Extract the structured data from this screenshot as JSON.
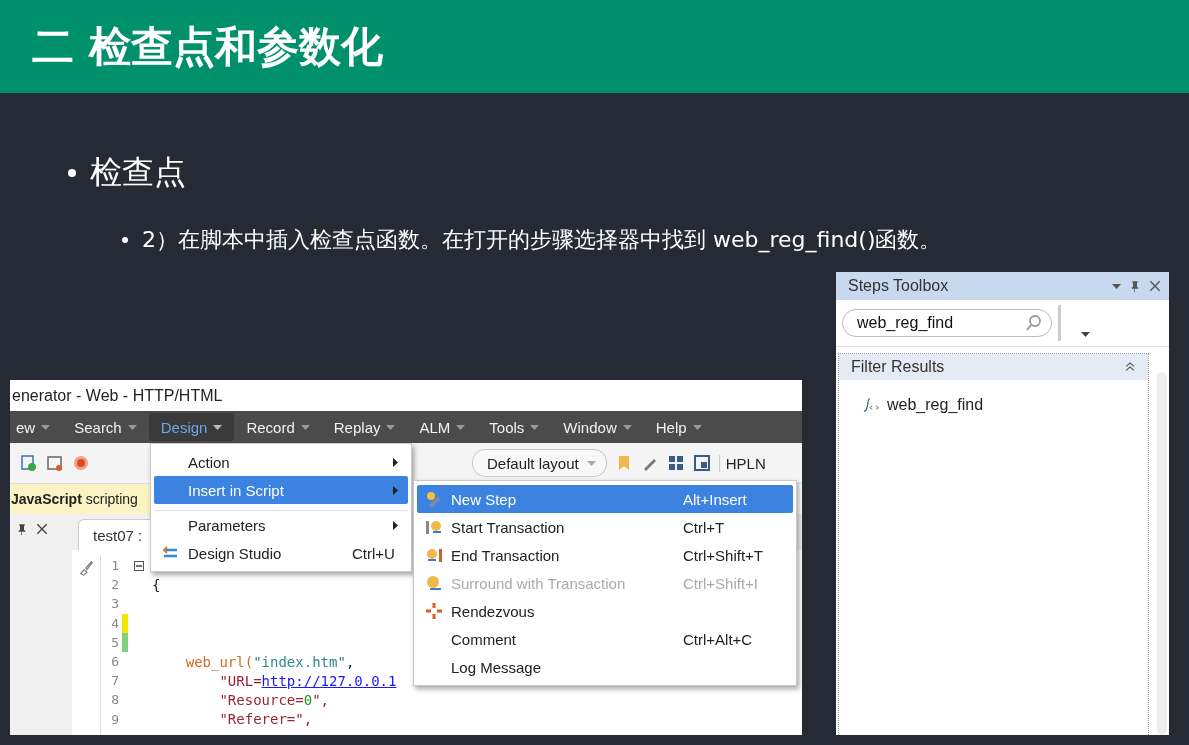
{
  "header": {
    "title": "二 检查点和参数化"
  },
  "bullets": [
    {
      "text": "检查点",
      "children": [
        {
          "text": "2）在脚本中插入检查点函数。在打开的步骤选择器中找到 web_reg_find()函数。"
        }
      ]
    }
  ],
  "vugen": {
    "title": "enerator - Web - HTTP/HTML",
    "menu": [
      {
        "label": "ew",
        "selected": false
      },
      {
        "label": "Search",
        "selected": false
      },
      {
        "label": "Design",
        "selected": true
      },
      {
        "label": "Record",
        "selected": false
      },
      {
        "label": "Replay",
        "selected": false
      },
      {
        "label": "ALM",
        "selected": false
      },
      {
        "label": "Tools",
        "selected": false
      },
      {
        "label": "Window",
        "selected": false
      },
      {
        "label": "Help",
        "selected": false
      }
    ],
    "layout_dropdown": "Default layout",
    "toolbar_label": "HPLN",
    "info_bar": "**JavaScript** scripting",
    "tab": "test07 :",
    "code_lines": [
      {
        "number": "1",
        "fold": true
      },
      {
        "number": "2",
        "tokens": [
          {
            "text": "{",
            "kind": "plain"
          }
        ]
      },
      {
        "number": "3"
      },
      {
        "number": "4",
        "color": "#f2e600"
      },
      {
        "number": "5",
        "color": "#7fd17f"
      },
      {
        "number": "6",
        "tokens": [
          {
            "text": "    web_url(",
            "kind": "func"
          },
          {
            "text": "\"index.htm\"",
            "kind": "string"
          },
          {
            "text": ",",
            "kind": "plain"
          }
        ]
      },
      {
        "number": "7",
        "tokens": [
          {
            "text": "        \"URL=",
            "kind": "attr"
          },
          {
            "text": "http://127.0.0.1",
            "kind": "link"
          }
        ]
      },
      {
        "number": "8",
        "tokens": [
          {
            "text": "        \"Resource=",
            "kind": "attr"
          },
          {
            "text": "0",
            "kind": "number"
          },
          {
            "text": "\",",
            "kind": "attr"
          }
        ]
      },
      {
        "number": "9",
        "tokens": [
          {
            "text": "        \"Referer=\",",
            "kind": "attr"
          }
        ]
      }
    ],
    "design_menu": [
      {
        "label": "Action",
        "submenu": true,
        "selected": false,
        "kind": "plain"
      },
      {
        "label": "Insert in Script",
        "submenu": true,
        "selected": true,
        "kind": "plain"
      },
      {
        "label": "Parameters",
        "submenu": true,
        "selected": false,
        "kind": "separated"
      },
      {
        "label": "Design Studio",
        "shortcut": "Ctrl+U",
        "submenu": false,
        "selected": false,
        "kind": "studio"
      }
    ],
    "insert_menu": [
      {
        "label": "New Step",
        "shortcut": "Alt+Insert",
        "selected": true,
        "disabled": false,
        "kind": "step"
      },
      {
        "label": "Start Transaction",
        "shortcut": "Ctrl+T",
        "selected": false,
        "disabled": false,
        "kind": "txn-start"
      },
      {
        "label": "End Transaction",
        "shortcut": "Ctrl+Shift+T",
        "selected": false,
        "disabled": false,
        "kind": "txn-end"
      },
      {
        "label": "Surround with Transaction",
        "shortcut": "Ctrl+Shift+I",
        "selected": false,
        "disabled": true,
        "kind": "txn-wrap"
      },
      {
        "label": "Rendezvous",
        "selected": false,
        "disabled": false,
        "kind": "rendezvous"
      },
      {
        "label": "Comment",
        "shortcut": "Ctrl+Alt+C",
        "selected": false,
        "disabled": false,
        "kind": "plain"
      },
      {
        "label": "Log Message",
        "selected": false,
        "disabled": false,
        "kind": "plain"
      }
    ]
  },
  "steps_toolbox": {
    "title": "Steps Toolbox",
    "search": "web_reg_find",
    "section": "Filter Results",
    "results": [
      {
        "label": "web_reg_find"
      }
    ]
  }
}
